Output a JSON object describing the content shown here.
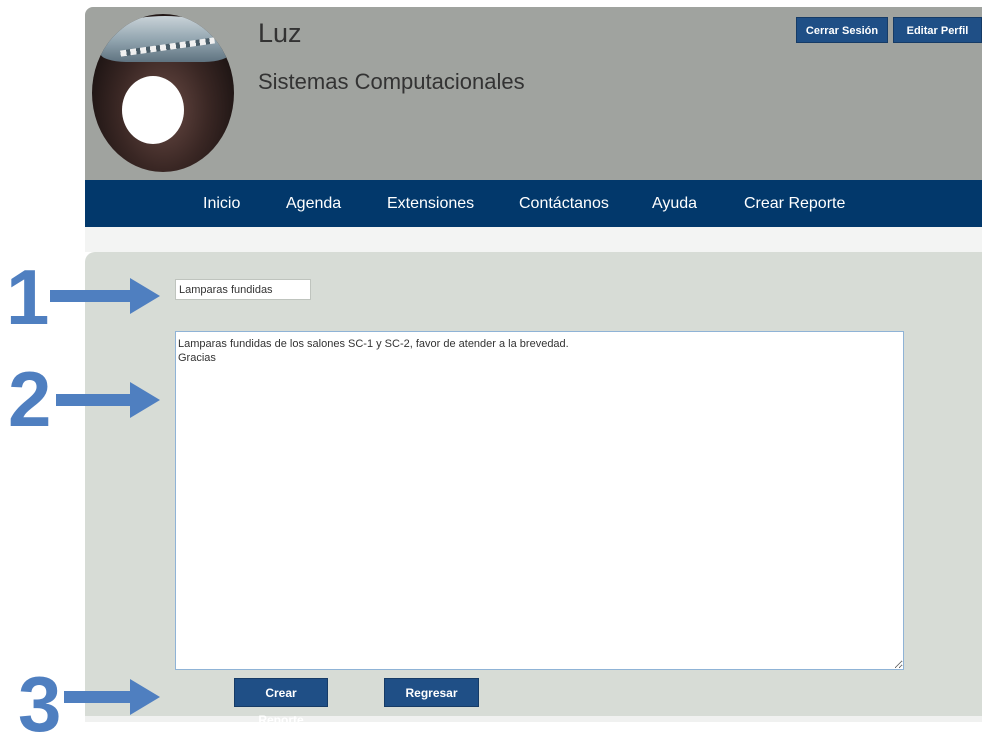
{
  "header": {
    "user_name": "Luz",
    "career": "Sistemas Computacionales",
    "logout_label": "Cerrar Sesión",
    "edit_profile_label": "Editar Perfil"
  },
  "nav": {
    "items": [
      {
        "label": "Inicio"
      },
      {
        "label": "Agenda"
      },
      {
        "label": "Extensiones"
      },
      {
        "label": "Contáctanos"
      },
      {
        "label": "Ayuda"
      },
      {
        "label": "Crear Reporte"
      }
    ]
  },
  "form": {
    "title_value": "Lamparas fundidas",
    "description_value": "Lamparas fundidas de los salones SC-1 y SC-2, favor de atender a la brevedad.\nGracias",
    "create_button": "Crear Reporte",
    "back_button": "Regresar"
  },
  "annotations": {
    "labels": [
      "1",
      "2",
      "3"
    ],
    "color": "#4f7fc0"
  },
  "colors": {
    "header_bg": "#a0a39f",
    "nav_bg": "#02386b",
    "button_bg": "#1f4f86",
    "form_bg": "#d7dcd6"
  }
}
